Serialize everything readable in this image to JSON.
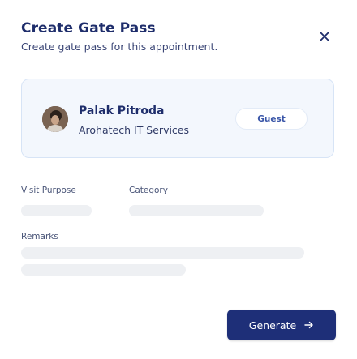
{
  "header": {
    "title": "Create Gate Pass",
    "subtitle": "Create gate pass for this appointment."
  },
  "icons": {
    "close": "close-icon",
    "arrow": "arrow-right-icon"
  },
  "visitor": {
    "name": "Palak Pitroda",
    "company": "Arohatech IT Services",
    "badge": "Guest"
  },
  "form": {
    "visit_purpose_label": "Visit Purpose",
    "category_label": "Category",
    "remarks_label": "Remarks"
  },
  "actions": {
    "generate_label": "Generate"
  },
  "colors": {
    "primary": "#1e2f78",
    "card_background": "#f3f7fd",
    "skeleton": "#eef0f3"
  }
}
